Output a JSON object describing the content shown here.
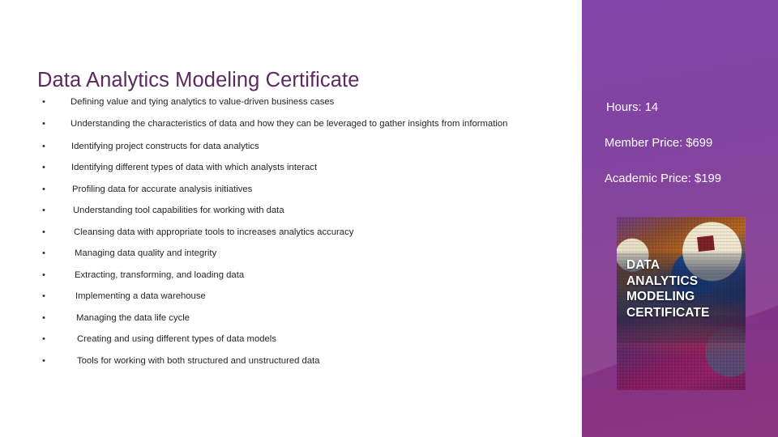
{
  "slide": {
    "title": "Data Analytics Modeling Certificate",
    "background_color": "#ffffff",
    "title_color": "#5c2a5e"
  },
  "bullets": [
    {
      "text": "Defining value and tying analytics to value-driven business cases"
    },
    {
      "text": "Understanding the characteristics of data and how they can be leveraged to gather insights from information"
    },
    {
      "text": "Identifying project constructs for data analytics"
    },
    {
      "text": "Identifying different types of data with which analysts interact"
    },
    {
      "text": "Profiling data for accurate analysis initiatives"
    },
    {
      "text": "Understanding tool capabilities for working with data"
    },
    {
      "text": "Cleansing data with appropriate tools to increases analytics accuracy"
    },
    {
      "text": "Managing data quality and integrity"
    },
    {
      "text": "Extracting, transforming, and loading data"
    },
    {
      "text": "Implementing a data warehouse"
    },
    {
      "text": "Managing the data life cycle"
    },
    {
      "text": "Creating and using different types of data models"
    },
    {
      "text": "Tools for working with both structured and unstructured data"
    }
  ],
  "bullet_marker": "•",
  "panel": {
    "gradient_top_color": "#7330a0",
    "gradient_bottom_color": "#8d3580",
    "facts": [
      {
        "label": "Hours: 14"
      },
      {
        "label": "Member Price: $699"
      },
      {
        "label": "Academic Price: $199"
      }
    ]
  },
  "cover": {
    "title_lines": [
      "DATA",
      "ANALYTICS",
      "MODELING",
      "CERTIFICATE"
    ]
  }
}
